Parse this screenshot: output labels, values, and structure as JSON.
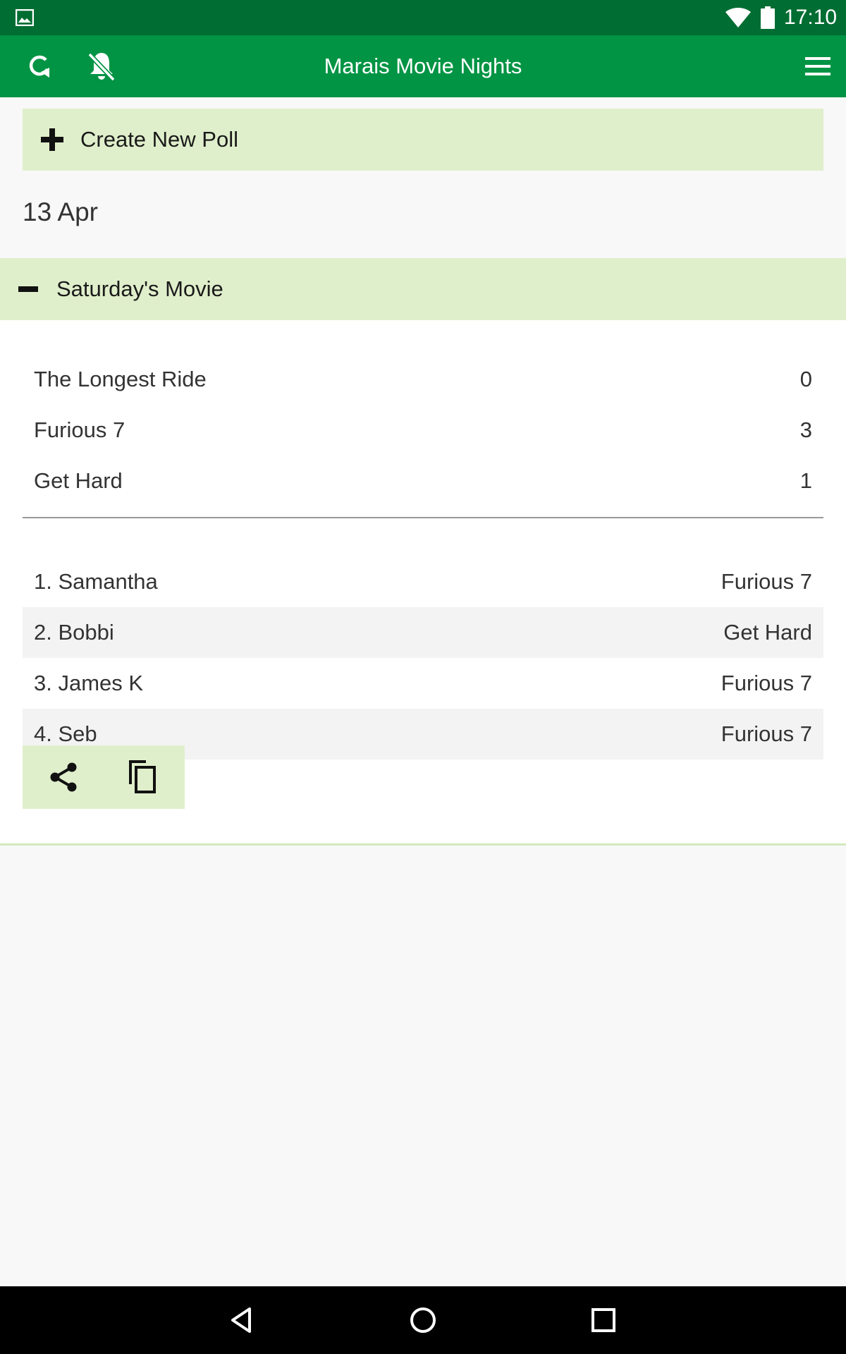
{
  "status_bar": {
    "time": "17:10",
    "icons": [
      "image-notification-icon",
      "wifi-icon",
      "battery-icon"
    ]
  },
  "app_bar": {
    "title": "Marais Movie Nights",
    "icons": [
      "refresh-icon",
      "notifications-off-icon",
      "menu-icon"
    ]
  },
  "create_poll": {
    "label": "Create New Poll",
    "icon": "plus-icon"
  },
  "date_heading": "13 Apr",
  "poll": {
    "title": "Saturday's Movie",
    "toggle_icon": "collapse-minus-icon",
    "results": [
      {
        "movie": "The Longest Ride",
        "count": "0"
      },
      {
        "movie": "Furious 7",
        "count": "3"
      },
      {
        "movie": "Get Hard",
        "count": "1"
      }
    ],
    "votes": [
      {
        "name": "1.  Samantha",
        "choice": "Furious 7"
      },
      {
        "name": "2.  Bobbi",
        "choice": "Get Hard"
      },
      {
        "name": "3.  James K",
        "choice": "Furious 7"
      },
      {
        "name": "4.  Seb",
        "choice": "Furious 7"
      }
    ],
    "actions": [
      "share-icon",
      "copy-icon"
    ]
  },
  "nav_bar": {
    "icons": [
      "back-icon",
      "home-icon",
      "recents-icon"
    ]
  },
  "colors": {
    "status_bar": "#006d32",
    "app_bar": "#009444",
    "accent_light": "#e0efcb",
    "background": "#f8f8f8"
  }
}
